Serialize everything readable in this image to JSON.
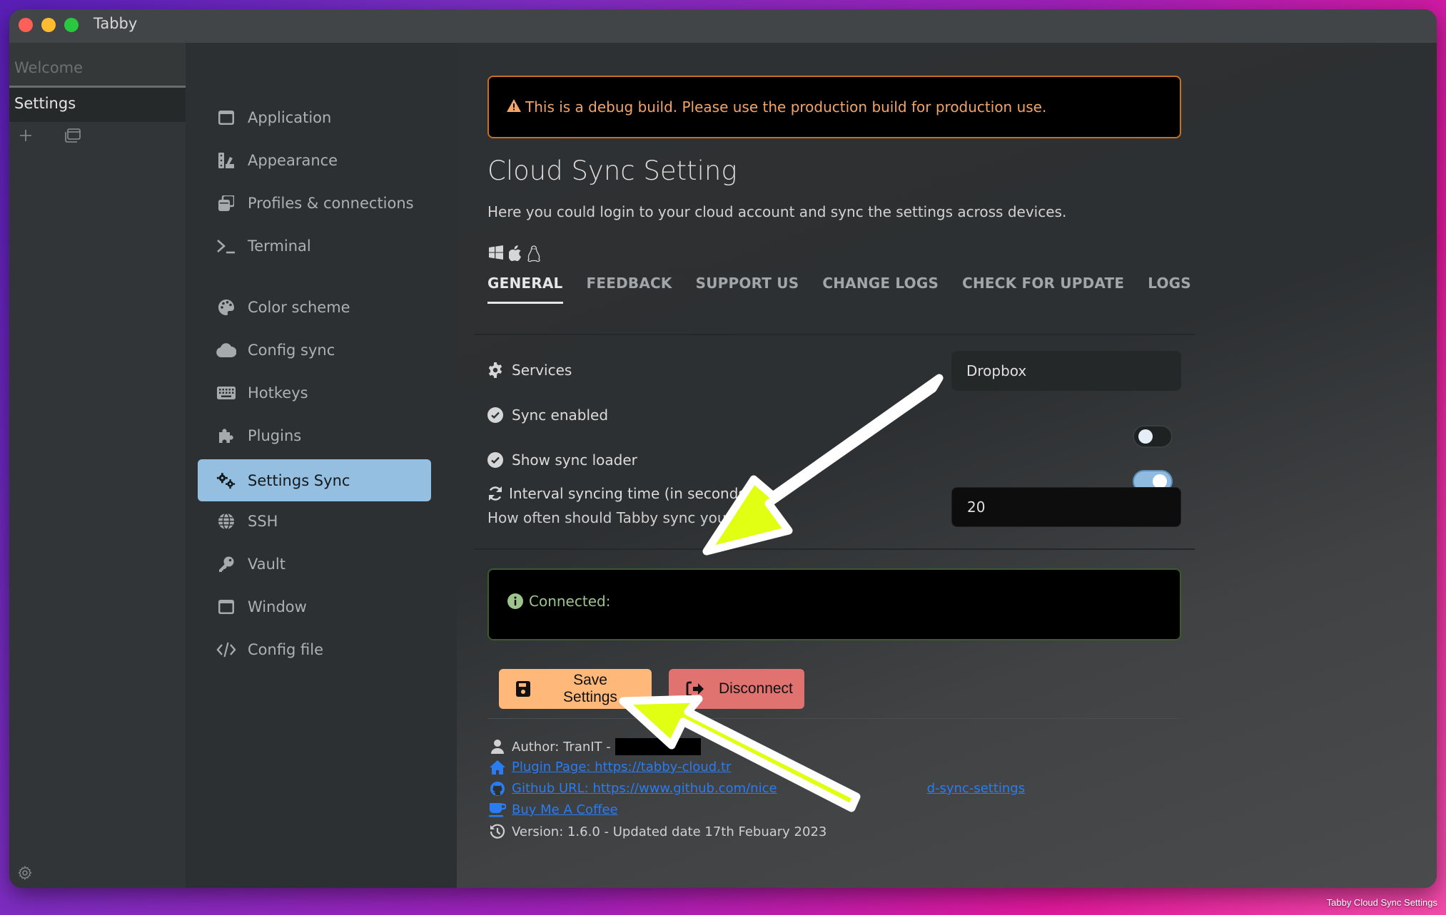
{
  "window": {
    "title": "Tabby",
    "tabs": [
      {
        "label": "Welcome",
        "active": false
      },
      {
        "label": "Settings",
        "active": true
      }
    ],
    "tab_actions": [
      "new-tab-icon",
      "window-icon"
    ],
    "footer_icon": "settings-gear-icon"
  },
  "nav": {
    "items": [
      {
        "label": "Application",
        "icon": "window-icon",
        "active": false
      },
      {
        "label": "Appearance",
        "icon": "swatchbook-icon",
        "active": false
      },
      {
        "label": "Profiles & connections",
        "icon": "clone-icon",
        "active": false
      },
      {
        "label": "Terminal",
        "icon": "terminal-icon",
        "active": false
      },
      {
        "label": "Color scheme",
        "icon": "palette-icon",
        "active": false
      },
      {
        "label": "Config sync",
        "icon": "cloud-icon",
        "active": false
      },
      {
        "label": "Hotkeys",
        "icon": "keyboard-icon",
        "active": false
      },
      {
        "label": "Plugins",
        "icon": "puzzle-icon",
        "active": false
      },
      {
        "label": "Settings Sync",
        "icon": "cogs-icon",
        "active": true
      },
      {
        "label": "SSH",
        "icon": "globe-icon",
        "active": false
      },
      {
        "label": "Vault",
        "icon": "key-icon",
        "active": false
      },
      {
        "label": "Window",
        "icon": "window-icon",
        "active": false
      },
      {
        "label": "Config file",
        "icon": "code-icon",
        "active": false
      }
    ]
  },
  "main": {
    "debug_alert": "This is a debug build. Please use the production build for production use.",
    "title": "Cloud Sync Setting",
    "description": "Here you could login to your cloud account and sync the settings across devices.",
    "os_icons": [
      "windows-icon",
      "apple-icon",
      "linux-icon"
    ],
    "tabs": [
      {
        "label": "GENERAL",
        "active": true
      },
      {
        "label": "FEEDBACK",
        "active": false
      },
      {
        "label": "SUPPORT US",
        "active": false
      },
      {
        "label": "CHANGE LOGS",
        "active": false
      },
      {
        "label": "CHECK FOR UPDATE",
        "active": false
      },
      {
        "label": "LOGS",
        "active": false
      }
    ],
    "settings": {
      "services_label": "Services",
      "services_value": "Dropbox",
      "sync_enabled_label": "Sync enabled",
      "sync_enabled": false,
      "show_loader_label": "Show sync loader",
      "show_loader": true,
      "interval_label": "Interval syncing time (in seconds)",
      "interval_help": "How often should Tabby sync your se",
      "interval_value": "20"
    },
    "connected_label": "Connected:",
    "buttons": {
      "save": "Save Settings",
      "disconnect": "Disconnect"
    },
    "footer": {
      "author": "Author: TranIT -",
      "plugin_page": "Plugin Page: https://tabby-cloud.tr",
      "github": "Github URL: https://www.github.com/nice",
      "github_tail": "d-sync-settings",
      "coffee": "Buy Me A Coffee",
      "version": "Version: 1.6.0 - Updated date 17th Febuary 2023"
    }
  },
  "caption": "Tabby Cloud Sync Settings",
  "colors": {
    "accent_active_nav": "#94bfe0",
    "warning": "#f2a56b",
    "success": "#9dc48a",
    "save_button": "#fdb87a",
    "disconnect_button": "#e07270",
    "link": "#2a7cf2",
    "annotation_arrow": "#e1ff12"
  }
}
